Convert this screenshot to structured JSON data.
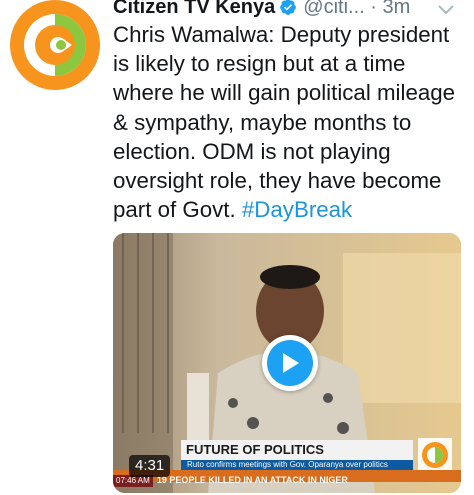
{
  "tweet": {
    "display_name": "Citizen TV Kenya",
    "handle": "@citi...",
    "separator": "·",
    "time": "3m",
    "text": "Chris Wamalwa: Deputy president is likely to resign but at a time where he will gain political mileage & sympathy, maybe months to election. ODM is not playing oversight role, they have become part of Govt. ",
    "hashtag": "#DayBreak",
    "icons": {
      "avatar": "citizen-tv-logo",
      "verified": "verified-badge-icon",
      "menu": "chevron-down-icon",
      "play": "play-icon"
    }
  },
  "video": {
    "duration": "4:31",
    "lower_third_title": "FUTURE OF POLITICS",
    "lower_third_sub": "Ruto confirms meetings with Gov. Oparanya over politics",
    "ticker_time": "07:46 AM",
    "ticker_text": "19 PEOPLE KILLED IN AN ATTACK IN NIGER"
  },
  "colors": {
    "name": "#14171a",
    "muted": "#657786",
    "link": "#1b95e0",
    "play": "#1da1f2",
    "brand_orange": "#f7941d",
    "brand_green": "#8dc63f"
  }
}
